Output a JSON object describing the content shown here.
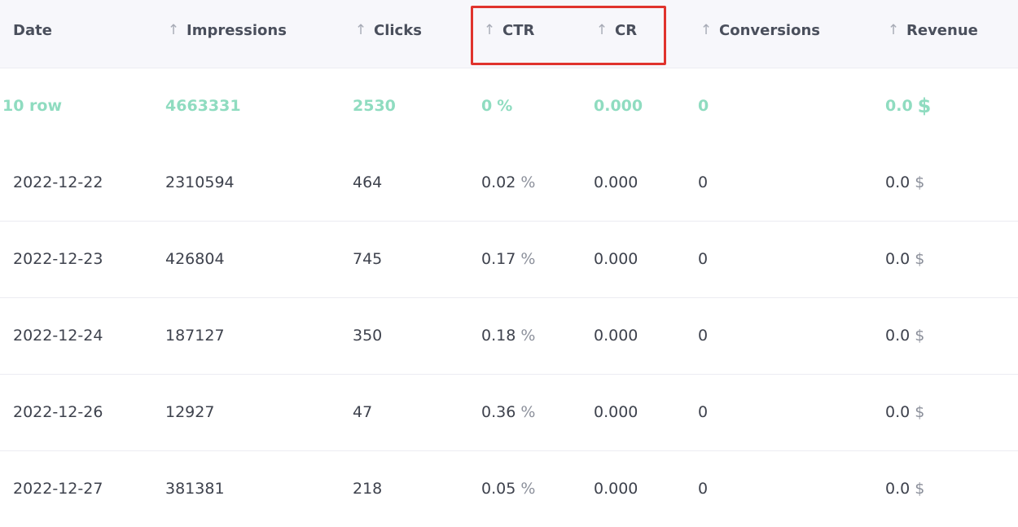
{
  "header": {
    "columns": [
      {
        "key": "date",
        "label": "Date",
        "sortable": false
      },
      {
        "key": "impressions",
        "label": "Impressions",
        "sortable": true
      },
      {
        "key": "clicks",
        "label": "Clicks",
        "sortable": true
      },
      {
        "key": "ctr",
        "label": "CTR",
        "sortable": true
      },
      {
        "key": "cr",
        "label": "CR",
        "sortable": true
      },
      {
        "key": "conversions",
        "label": "Conversions",
        "sortable": true
      },
      {
        "key": "revenue",
        "label": "Revenue",
        "sortable": true
      }
    ],
    "sort_glyph": "↑",
    "highlight_color": "#e0332d"
  },
  "summary": {
    "date": "10 row",
    "impressions": "4663331",
    "clicks": "2530",
    "ctr_value": "0",
    "ctr_unit": "%",
    "cr": "0.000",
    "conversions": "0",
    "revenue_value": "0.0",
    "revenue_unit": "$",
    "color": "#8fdcc0"
  },
  "rows": [
    {
      "date": "2022-12-22",
      "impressions": "2310594",
      "clicks": "464",
      "ctr_value": "0.02",
      "ctr_unit": "%",
      "cr": "0.000",
      "conversions": "0",
      "revenue_value": "0.0",
      "revenue_unit": "$"
    },
    {
      "date": "2022-12-23",
      "impressions": "426804",
      "clicks": "745",
      "ctr_value": "0.17",
      "ctr_unit": "%",
      "cr": "0.000",
      "conversions": "0",
      "revenue_value": "0.0",
      "revenue_unit": "$"
    },
    {
      "date": "2022-12-24",
      "impressions": "187127",
      "clicks": "350",
      "ctr_value": "0.18",
      "ctr_unit": "%",
      "cr": "0.000",
      "conversions": "0",
      "revenue_value": "0.0",
      "revenue_unit": "$"
    },
    {
      "date": "2022-12-26",
      "impressions": "12927",
      "clicks": "47",
      "ctr_value": "0.36",
      "ctr_unit": "%",
      "cr": "0.000",
      "conversions": "0",
      "revenue_value": "0.0",
      "revenue_unit": "$"
    },
    {
      "date": "2022-12-27",
      "impressions": "381381",
      "clicks": "218",
      "ctr_value": "0.05",
      "ctr_unit": "%",
      "cr": "0.000",
      "conversions": "0",
      "revenue_value": "0.0",
      "revenue_unit": "$"
    }
  ]
}
